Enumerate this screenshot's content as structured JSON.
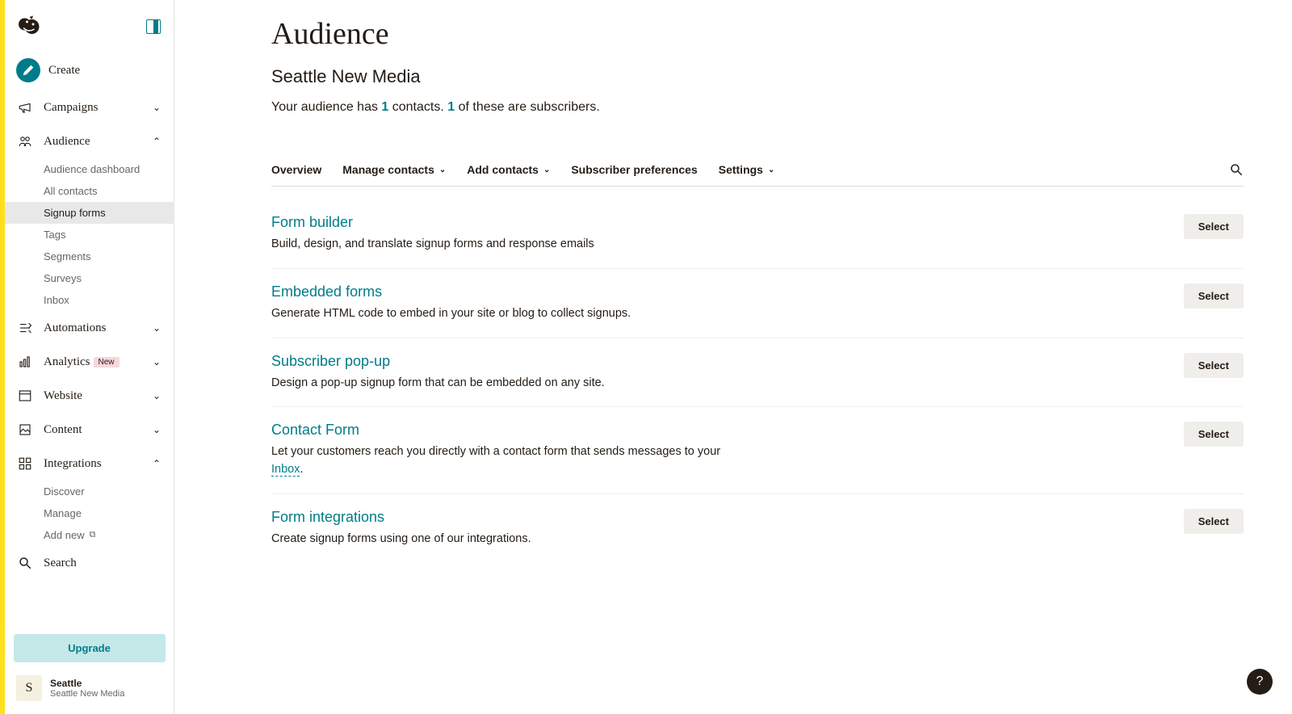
{
  "sidebar": {
    "create": {
      "label": "Create"
    },
    "items": [
      {
        "label": "Campaigns",
        "expanded": false
      },
      {
        "label": "Audience",
        "expanded": true,
        "subitems": [
          {
            "label": "Audience dashboard"
          },
          {
            "label": "All contacts"
          },
          {
            "label": "Signup forms",
            "active": true
          },
          {
            "label": "Tags"
          },
          {
            "label": "Segments"
          },
          {
            "label": "Surveys"
          },
          {
            "label": "Inbox"
          }
        ]
      },
      {
        "label": "Automations",
        "expanded": false
      },
      {
        "label": "Analytics",
        "expanded": false,
        "badge": "New"
      },
      {
        "label": "Website",
        "expanded": false
      },
      {
        "label": "Content",
        "expanded": false
      },
      {
        "label": "Integrations",
        "expanded": true,
        "subitems": [
          {
            "label": "Discover"
          },
          {
            "label": "Manage"
          },
          {
            "label": "Add new",
            "external": true
          }
        ]
      }
    ],
    "search": {
      "label": "Search"
    },
    "upgrade": {
      "label": "Upgrade"
    },
    "account": {
      "avatar_letter": "S",
      "name": "Seattle",
      "sub": "Seattle New Media"
    }
  },
  "page": {
    "title": "Audience",
    "subtitle": "Seattle New Media",
    "summary": {
      "prefix": "Your audience has ",
      "contacts": "1",
      "middle": " contacts. ",
      "subscribers": "1",
      "suffix": " of these are subscribers."
    }
  },
  "tabs": [
    {
      "label": "Overview"
    },
    {
      "label": "Manage contacts",
      "dropdown": true
    },
    {
      "label": "Add contacts",
      "dropdown": true
    },
    {
      "label": "Subscriber preferences"
    },
    {
      "label": "Settings",
      "dropdown": true
    }
  ],
  "forms": [
    {
      "title": "Form builder",
      "desc": "Build, design, and translate signup forms and response emails",
      "select": "Select"
    },
    {
      "title": "Embedded forms",
      "desc": "Generate HTML code to embed in your site or blog to collect signups.",
      "select": "Select"
    },
    {
      "title": "Subscriber pop-up",
      "desc": "Design a pop-up signup form that can be embedded on any site.",
      "select": "Select"
    },
    {
      "title": "Contact Form",
      "desc_prefix": "Let your customers reach you directly with a contact form that sends messages to your ",
      "link": "Inbox",
      "desc_suffix": ".",
      "select": "Select"
    },
    {
      "title": "Form integrations",
      "desc": "Create signup forms using one of our integrations.",
      "select": "Select"
    }
  ],
  "help": {
    "symbol": "?"
  }
}
